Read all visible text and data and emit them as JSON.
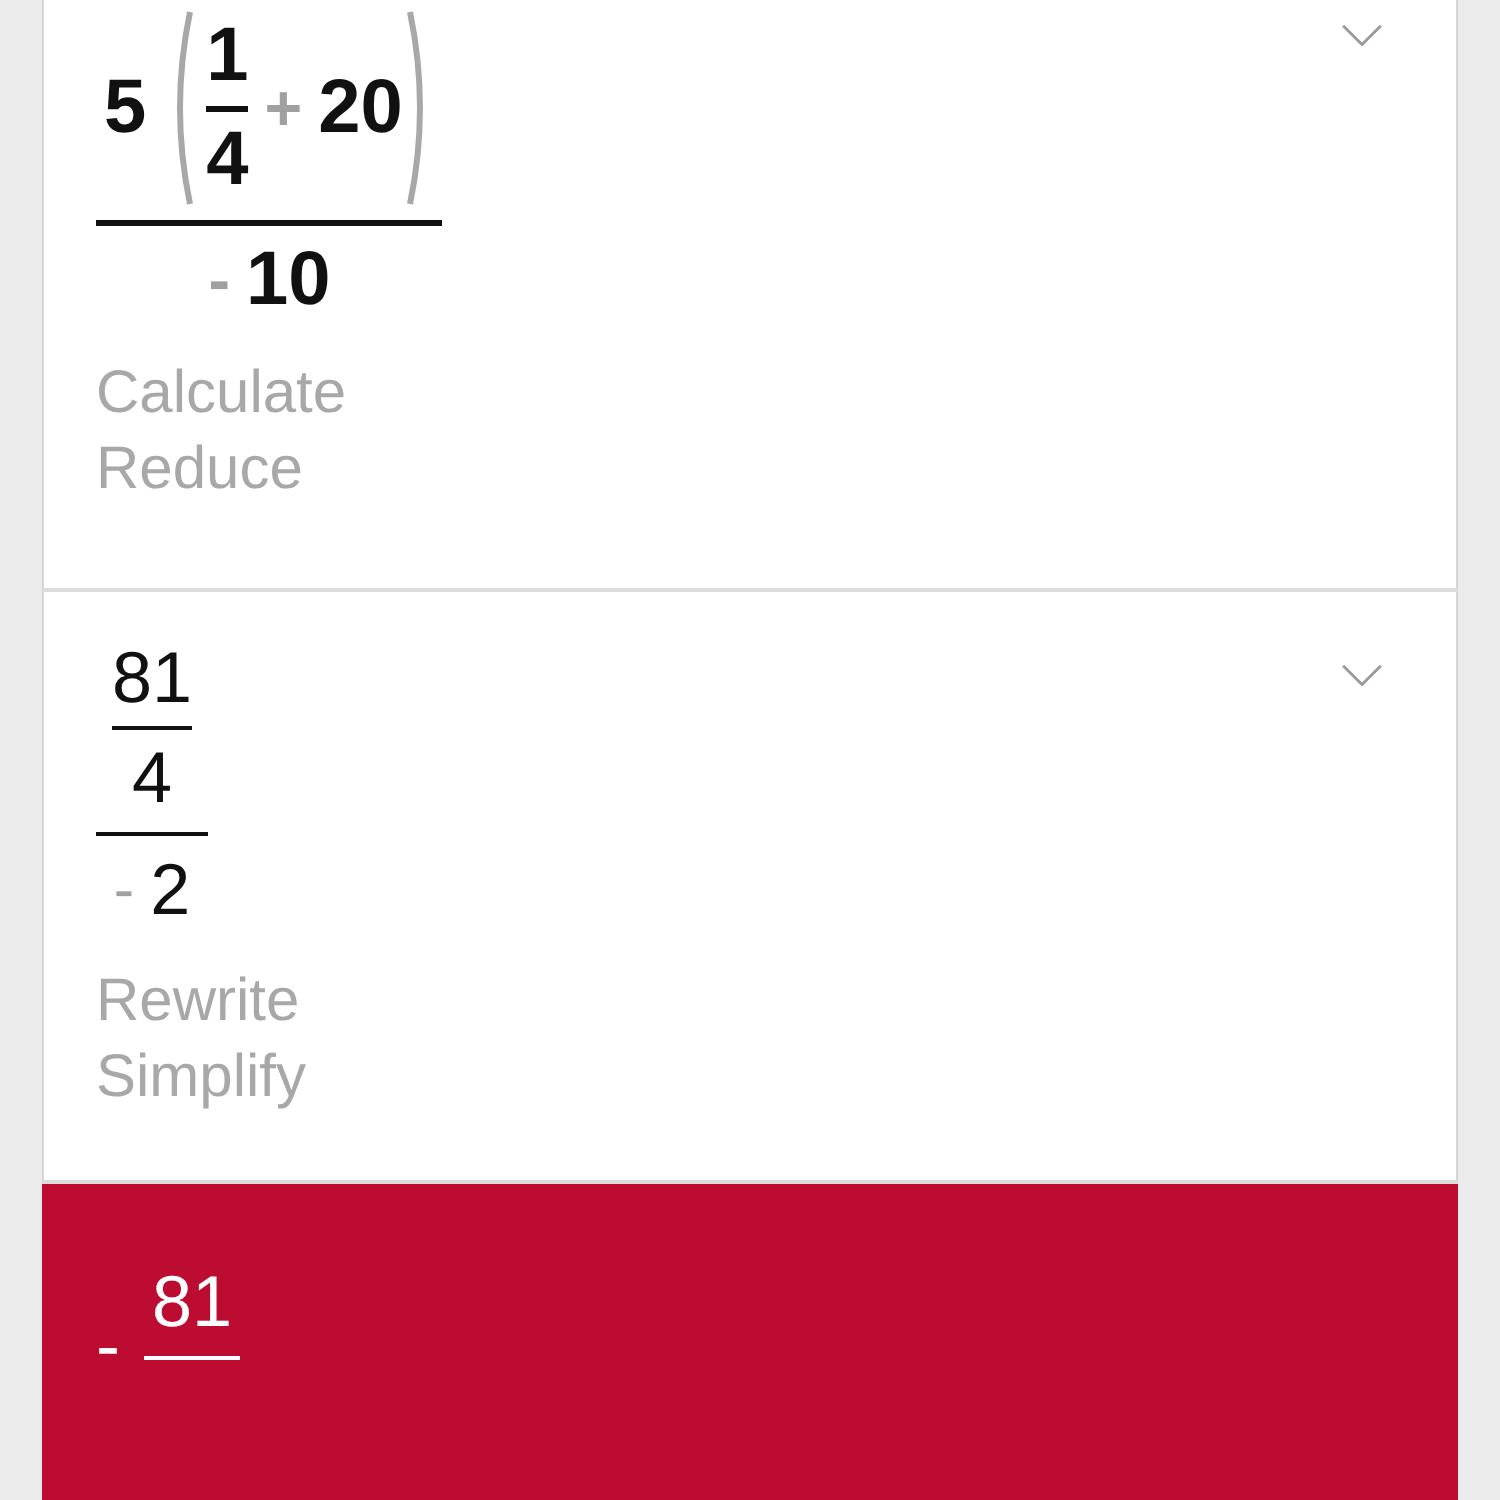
{
  "steps": [
    {
      "kind": "step",
      "selected": false,
      "bold": true,
      "expression": [
        {
          "kind": "frac",
          "num": [
            {
              "kind": "num",
              "text": "5"
            },
            {
              "kind": "paren",
              "body": [
                {
                  "kind": "frac",
                  "num": [
                    {
                      "kind": "num",
                      "text": "1"
                    }
                  ],
                  "den": [
                    {
                      "kind": "num",
                      "text": "4"
                    }
                  ]
                },
                {
                  "kind": "op",
                  "text": "+"
                },
                {
                  "kind": "num",
                  "text": "20"
                }
              ]
            }
          ],
          "den": [
            {
              "kind": "op",
              "text": "-"
            },
            {
              "kind": "num",
              "text": "10"
            }
          ]
        }
      ],
      "labels": [
        "Calculate",
        "Reduce"
      ]
    },
    {
      "kind": "step",
      "selected": false,
      "bold": false,
      "expression": [
        {
          "kind": "frac",
          "num": [
            {
              "kind": "frac",
              "num": [
                {
                  "kind": "num",
                  "text": "81"
                }
              ],
              "den": [
                {
                  "kind": "num",
                  "text": "4"
                }
              ]
            }
          ],
          "den": [
            {
              "kind": "op",
              "text": "-"
            },
            {
              "kind": "num",
              "text": "2"
            }
          ]
        }
      ],
      "labels": [
        "Rewrite",
        "Simplify"
      ]
    },
    {
      "kind": "answer",
      "selected": true,
      "bold": false,
      "expression": [
        {
          "kind": "op",
          "text": "-"
        },
        {
          "kind": "frac",
          "num": [
            {
              "kind": "num",
              "text": "81"
            }
          ]
        }
      ]
    }
  ]
}
